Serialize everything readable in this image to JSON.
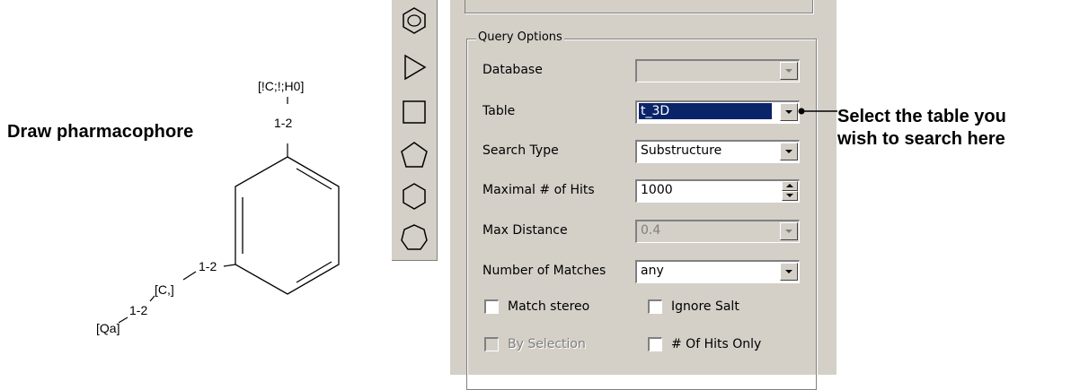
{
  "annotation": {
    "draw_label": "Draw pharmacophore",
    "callout_line1": "Select the table you",
    "callout_line2": "wish to search here"
  },
  "molecule": {
    "atom_top": "[!C;!;H0]",
    "bond_top": "1-2",
    "bond_ring": "1-2",
    "atom_mid": "[C,]",
    "bond_mid": "1-2",
    "atom_end": "[Qa]"
  },
  "toolbar": {
    "tools": [
      "benzene-ring-icon",
      "triangle-icon",
      "square-icon",
      "pentagon-icon",
      "hexagon-icon",
      "heptagon-icon"
    ]
  },
  "query_options": {
    "title": "Query Options",
    "fields": [
      {
        "label": "Database",
        "value": "",
        "enabled": true,
        "label_disabled": false,
        "control": "combo"
      },
      {
        "label": "Table",
        "value": "t_3D",
        "enabled": true,
        "control": "combo",
        "selected": true
      },
      {
        "label": "Search Type",
        "value": "Substructure",
        "enabled": true,
        "control": "combo"
      },
      {
        "label": "Maximal # of Hits",
        "value": "1000",
        "enabled": true,
        "control": "spinner"
      },
      {
        "label": "Max Distance",
        "value": "0.4",
        "enabled": false,
        "control": "combo"
      },
      {
        "label": "Number of Matches",
        "value": "any",
        "enabled": true,
        "control": "combo"
      }
    ],
    "checkboxes": [
      {
        "label": "Match stereo",
        "checked": false,
        "enabled": true
      },
      {
        "label": "Ignore Salt",
        "checked": false,
        "enabled": true
      },
      {
        "label": "By Selection",
        "checked": false,
        "enabled": false
      },
      {
        "label": "# Of Hits Only",
        "checked": false,
        "enabled": true
      }
    ]
  },
  "colors": {
    "panel": "#d4d0c8",
    "selection": "#0a246a",
    "shadow": "#808080"
  }
}
